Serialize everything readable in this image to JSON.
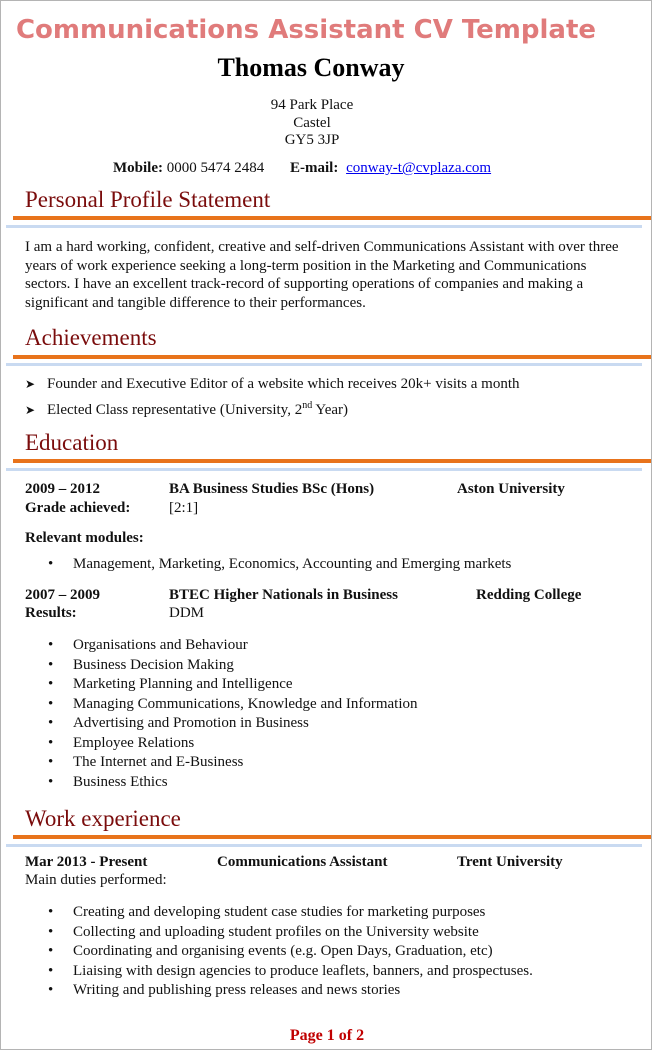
{
  "document": {
    "title": "Communications Assistant CV Template",
    "name": "Thomas Conway",
    "address": [
      "94 Park Place",
      "Castel",
      "GY5 3JP"
    ],
    "contact": {
      "mobile_label": "Mobile:",
      "mobile": "0000 5474 2484",
      "email_label": "E-mail:",
      "email": "conway-t@cvplaza.com"
    },
    "colors": {
      "title": "#e07b7b",
      "section_heading": "#7a0c0c",
      "rule_orange": "#e8731b",
      "rule_blue": "#c9daf1",
      "link": "#0000ee",
      "footer": "#c00000"
    }
  },
  "profile": {
    "heading": "Personal Profile Statement",
    "text": "I am a hard working, confident, creative and self-driven Communications Assistant with over three years of work experience seeking a long-term position in the Marketing and Communications sectors. I have an excellent track-record of supporting operations of companies and making a significant and tangible difference to their performances."
  },
  "achievements": {
    "heading": "Achievements",
    "bullet_icon": "arrow-bullet-icon",
    "items": [
      {
        "text": "Founder and Executive Editor of a website which receives 20k+ visits a month"
      },
      {
        "text_before": "Elected Class representative (University, 2",
        "sup": "nd",
        "text_after": " Year)"
      }
    ]
  },
  "education": {
    "heading": "Education",
    "entries": [
      {
        "dates": "2009 – 2012",
        "qualification": "BA Business Studies BSc (Hons)",
        "institution": "Aston University",
        "result_label": "Grade achieved:",
        "result": "[2:1]",
        "modules_label": "Relevant modules:",
        "modules": [
          "Management, Marketing, Economics, Accounting and Emerging markets"
        ]
      },
      {
        "dates": "2007 – 2009",
        "qualification": "BTEC Higher Nationals in Business",
        "institution": "Redding College",
        "result_label": "Results:",
        "result": "DDM",
        "modules": [
          "Organisations and Behaviour",
          "Business Decision Making",
          "Marketing Planning and Intelligence",
          "Managing Communications, Knowledge and Information",
          "Advertising and Promotion in Business",
          "Employee Relations",
          "The Internet and E-Business",
          "Business Ethics"
        ]
      }
    ]
  },
  "work": {
    "heading": "Work experience",
    "entries": [
      {
        "dates": "Mar 2013 - Present",
        "role": "Communications Assistant",
        "employer": "Trent University",
        "duties_label": "Main duties performed:",
        "duties": [
          "Creating and developing student case studies for marketing purposes",
          "Collecting and uploading student profiles on the University website",
          "Coordinating and organising events (e.g. Open Days, Graduation, etc)",
          "Liaising with design agencies to produce leaflets, banners, and prospectuses.",
          "Writing and publishing press releases and news stories"
        ]
      }
    ]
  },
  "footer": {
    "page_label": "Page 1 of 2"
  }
}
